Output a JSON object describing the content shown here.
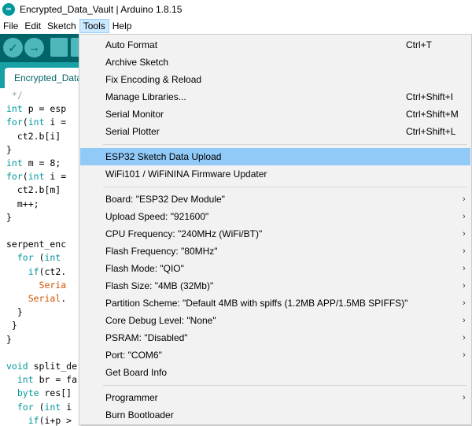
{
  "window": {
    "title": "Encrypted_Data_Vault | Arduino 1.8.15",
    "app_icon_glyph": "∞"
  },
  "menubar": {
    "items": [
      {
        "label": "File"
      },
      {
        "label": "Edit"
      },
      {
        "label": "Sketch"
      },
      {
        "label": "Tools"
      },
      {
        "label": "Help"
      }
    ],
    "active": "Tools"
  },
  "toolbar": {
    "verify_glyph": "✓",
    "upload_glyph": "→"
  },
  "tab": {
    "label": "Encrypted_Data_Vault"
  },
  "code": [
    {
      "t": " */",
      "c": "cm"
    },
    {
      "t": "int p = esp"
    },
    {
      "t": "for(int i ="
    },
    {
      "t": "  ct2.b[i]"
    },
    {
      "t": "}"
    },
    {
      "t": "int m = 8;"
    },
    {
      "t": "for(int i ="
    },
    {
      "t": "  ct2.b[m]"
    },
    {
      "t": "  m++;"
    },
    {
      "t": "}"
    },
    {
      "t": ""
    },
    {
      "t": "serpent_enc"
    },
    {
      "t": "  for (int"
    },
    {
      "t": "    if(ct2."
    },
    {
      "t": "      Seria"
    },
    {
      "t": "    Serial."
    },
    {
      "t": "  }"
    },
    {
      "t": " }"
    },
    {
      "t": "}"
    },
    {
      "t": ""
    },
    {
      "t": "void split_de"
    },
    {
      "t": "  int br = fa"
    },
    {
      "t": "  byte res[]"
    },
    {
      "t": "  for (int i"
    },
    {
      "t": "    if(i+p >"
    }
  ],
  "tools_menu": {
    "items": [
      {
        "label": "Auto Format",
        "shortcut": "Ctrl+T"
      },
      {
        "label": "Archive Sketch"
      },
      {
        "label": "Fix Encoding & Reload"
      },
      {
        "label": "Manage Libraries...",
        "shortcut": "Ctrl+Shift+I"
      },
      {
        "label": "Serial Monitor",
        "shortcut": "Ctrl+Shift+M"
      },
      {
        "label": "Serial Plotter",
        "shortcut": "Ctrl+Shift+L"
      },
      {
        "sep": true
      },
      {
        "label": "ESP32 Sketch Data Upload",
        "highlight": true
      },
      {
        "label": "WiFi101 / WiFiNINA Firmware Updater"
      },
      {
        "sep": true
      },
      {
        "label": "Board: \"ESP32 Dev Module\"",
        "submenu": true
      },
      {
        "label": "Upload Speed: \"921600\"",
        "submenu": true
      },
      {
        "label": "CPU Frequency: \"240MHz (WiFi/BT)\"",
        "submenu": true
      },
      {
        "label": "Flash Frequency: \"80MHz\"",
        "submenu": true
      },
      {
        "label": "Flash Mode: \"QIO\"",
        "submenu": true
      },
      {
        "label": "Flash Size: \"4MB (32Mb)\"",
        "submenu": true
      },
      {
        "label": "Partition Scheme: \"Default 4MB with spiffs (1.2MB APP/1.5MB SPIFFS)\"",
        "submenu": true
      },
      {
        "label": "Core Debug Level: \"None\"",
        "submenu": true
      },
      {
        "label": "PSRAM: \"Disabled\"",
        "submenu": true
      },
      {
        "label": "Port: \"COM6\"",
        "submenu": true
      },
      {
        "label": "Get Board Info"
      },
      {
        "sep": true
      },
      {
        "label": "Programmer",
        "submenu": true
      },
      {
        "label": "Burn Bootloader"
      }
    ],
    "submenu_glyph": "›"
  },
  "colors": {
    "accent": "#00979c",
    "toolbar": "#006468",
    "tabbar": "#17a1a5",
    "menu_highlight": "#91c9f7"
  }
}
